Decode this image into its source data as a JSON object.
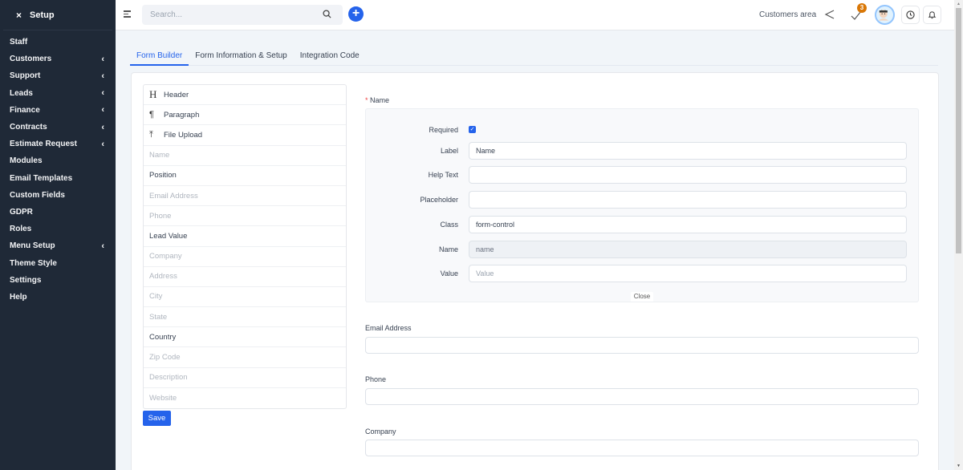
{
  "sidebar": {
    "close_icon": "×",
    "title": "Setup",
    "items": [
      {
        "label": "Staff",
        "has_children": false
      },
      {
        "label": "Customers",
        "has_children": true
      },
      {
        "label": "Support",
        "has_children": true
      },
      {
        "label": "Leads",
        "has_children": true
      },
      {
        "label": "Finance",
        "has_children": true
      },
      {
        "label": "Contracts",
        "has_children": true
      },
      {
        "label": "Estimate Request",
        "has_children": true
      },
      {
        "label": "Modules",
        "has_children": false
      },
      {
        "label": "Email Templates",
        "has_children": false
      },
      {
        "label": "Custom Fields",
        "has_children": false
      },
      {
        "label": "GDPR",
        "has_children": false
      },
      {
        "label": "Roles",
        "has_children": false
      },
      {
        "label": "Menu Setup",
        "has_children": true
      },
      {
        "label": "Theme Style",
        "has_children": false
      },
      {
        "label": "Settings",
        "has_children": false
      },
      {
        "label": "Help",
        "has_children": false
      }
    ],
    "chevron": "‹"
  },
  "topbar": {
    "search_placeholder": "Search...",
    "plus_label": "+",
    "customers_area": "Customers area",
    "tasks_badge": "3",
    "accent": "#2563eb",
    "badge_color": "#d97706"
  },
  "tabs": [
    {
      "label": "Form Builder",
      "active": true
    },
    {
      "label": "Form Information & Setup",
      "active": false
    },
    {
      "label": "Integration Code",
      "active": false
    }
  ],
  "builder": {
    "controls": [
      {
        "icon": "H",
        "icon_name": "header-icon",
        "label": "Header"
      },
      {
        "icon": "¶",
        "icon_name": "paragraph-icon",
        "label": "Paragraph"
      },
      {
        "icon": "⤒",
        "icon_name": "upload-icon",
        "label": "File Upload"
      }
    ],
    "fields": [
      {
        "label": "Name",
        "used": true
      },
      {
        "label": "Position",
        "used": false
      },
      {
        "label": "Email Address",
        "used": true
      },
      {
        "label": "Phone",
        "used": true
      },
      {
        "label": "Lead Value",
        "used": false
      },
      {
        "label": "Company",
        "used": true
      },
      {
        "label": "Address",
        "used": true
      },
      {
        "label": "City",
        "used": true
      },
      {
        "label": "State",
        "used": true
      },
      {
        "label": "Country",
        "used": false
      },
      {
        "label": "Zip Code",
        "used": true
      },
      {
        "label": "Description",
        "used": true
      },
      {
        "label": "Website",
        "used": true
      }
    ],
    "save_label": "Save"
  },
  "form": {
    "name_field": {
      "star": "*",
      "label": "Name",
      "edit": {
        "required_label": "Required",
        "required_checked": true,
        "label_label": "Label",
        "label_value": "Name",
        "help_label": "Help Text",
        "help_value": "",
        "placeholder_label": "Placeholder",
        "placeholder_value": "",
        "class_label": "Class",
        "class_value": "form-control",
        "name_label": "Name",
        "name_value": "name",
        "value_label": "Value",
        "value_placeholder": "Value",
        "close_label": "Close"
      }
    },
    "other_fields": [
      {
        "label": "Email Address"
      },
      {
        "label": "Phone"
      },
      {
        "label": "Company"
      }
    ]
  }
}
